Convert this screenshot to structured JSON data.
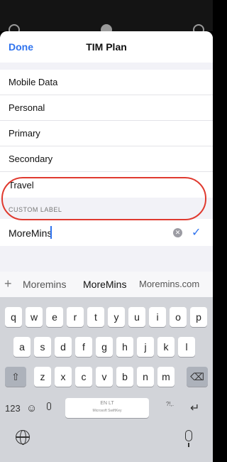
{
  "nav": {
    "done_label": "Done",
    "title": "TIM Plan"
  },
  "labels": [
    "Mobile Data",
    "Personal",
    "Primary",
    "Secondary",
    "Travel"
  ],
  "custom": {
    "section_label": "CUSTOM LABEL",
    "value": "MoreMins"
  },
  "suggestions": {
    "plus": "+",
    "items": [
      "Moremins",
      "MoreMins",
      "Moremins.com"
    ]
  },
  "keyboard": {
    "row1": [
      "q",
      "w",
      "e",
      "r",
      "t",
      "y",
      "u",
      "i",
      "o",
      "p"
    ],
    "row2": [
      "a",
      "s",
      "d",
      "f",
      "g",
      "h",
      "j",
      "k",
      "l"
    ],
    "row3": [
      "z",
      "x",
      "c",
      "v",
      "b",
      "n",
      "m"
    ],
    "numbers_key": "123",
    "space_lang": "EN LT",
    "space_brand": "Microsoft SwiftKey",
    "punct_key": "?!,."
  },
  "icons": [
    "close-icon",
    "record-icon",
    "settings-icon",
    "checkmark-icon",
    "clear-icon",
    "shift-icon",
    "delete-icon",
    "emoji-icon",
    "microphone-icon",
    "return-icon",
    "globe-icon"
  ]
}
